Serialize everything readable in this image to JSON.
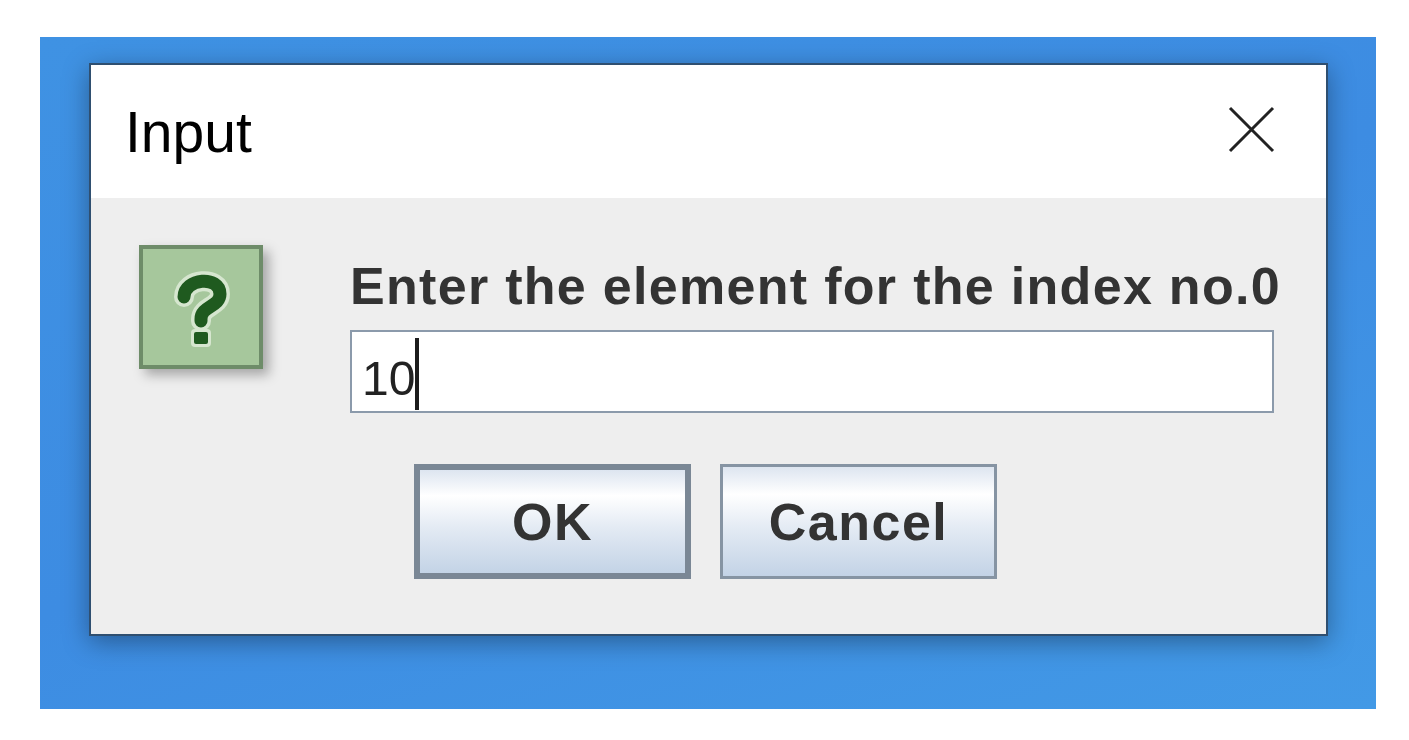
{
  "window": {
    "title": "Input"
  },
  "dialog": {
    "icon": {
      "kind": "question"
    },
    "message": "Enter the element for the index no.0",
    "input": {
      "value": "10",
      "focused": true
    },
    "buttons": [
      {
        "label": "OK",
        "default": true
      },
      {
        "label": "Cancel",
        "default": false
      }
    ]
  }
}
